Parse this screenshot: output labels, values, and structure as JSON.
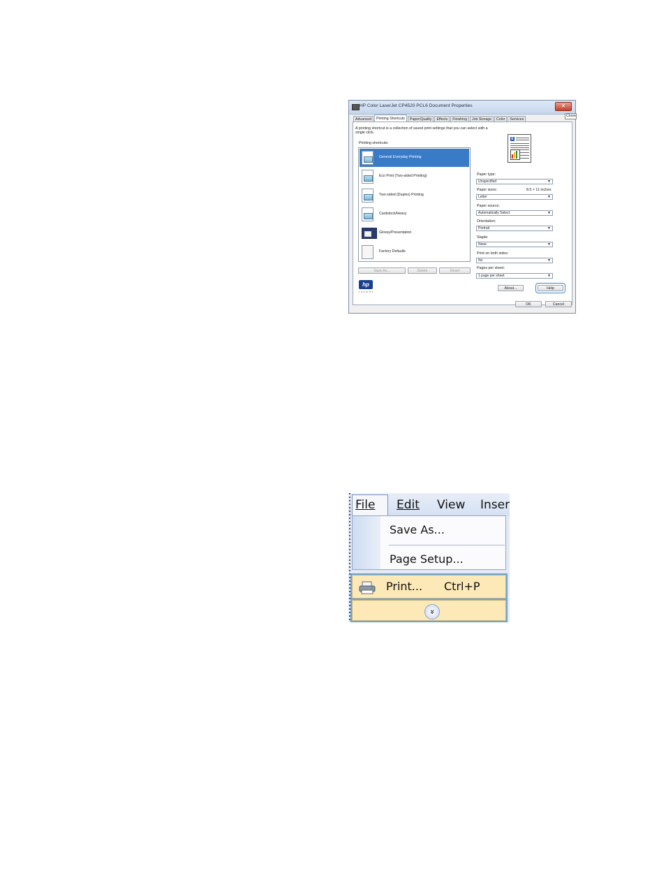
{
  "dialog": {
    "title": "HP Color LaserJet CP4520 PCL6 Document Properties",
    "close_tooltip": "Close",
    "tabs": [
      "Advanced",
      "Printing Shortcuts",
      "Paper/Quality",
      "Effects",
      "Finishing",
      "Job Storage",
      "Color",
      "Services"
    ],
    "active_tab": "Printing Shortcuts",
    "description": "A printing shortcut is a collection of saved print settings that you can select with a single click.",
    "shortcuts_label": "Printing shortcuts:",
    "shortcuts": [
      {
        "label": "General Everyday Printing",
        "selected": true
      },
      {
        "label": "Eco Print (Two-sided Printing)",
        "selected": false
      },
      {
        "label": "Two-sided (Duplex) Printing",
        "selected": false
      },
      {
        "label": "Cardstock/Heavy",
        "selected": false
      },
      {
        "label": "Glossy/Presentation",
        "selected": false
      },
      {
        "label": "Factory Defaults",
        "selected": false
      }
    ],
    "buttons": {
      "save_as": "Save As...",
      "delete": "Delete",
      "reset": "Reset",
      "about": "About...",
      "help": "Help",
      "ok": "OK",
      "cancel": "Cancel"
    },
    "settings": {
      "paper_type_label": "Paper type:",
      "paper_type": "Unspecified",
      "paper_sizes_label": "Paper sizes:",
      "paper_sizes_dim": "8.5 × 11 inches",
      "paper_size": "Letter",
      "paper_source_label": "Paper source:",
      "paper_source": "Automatically Select",
      "orientation_label": "Orientation:",
      "orientation": "Portrait",
      "staple_label": "Staple:",
      "staple": "None",
      "both_sides_label": "Print on both sides:",
      "both_sides": "No",
      "pages_per_sheet_label": "Pages per sheet:",
      "pages_per_sheet": "1 page per sheet"
    },
    "logo_text": "hp",
    "logo_tagline": "invent",
    "accent": "#3a7bc8"
  },
  "menu": {
    "bar": [
      "File",
      "Edit",
      "View",
      "Inser"
    ],
    "items": {
      "save_as": "Save As...",
      "page_setup": "Page Setup...",
      "print": "Print...",
      "print_shortcut": "Ctrl+P"
    },
    "highlight_color": "#fde9b8"
  }
}
